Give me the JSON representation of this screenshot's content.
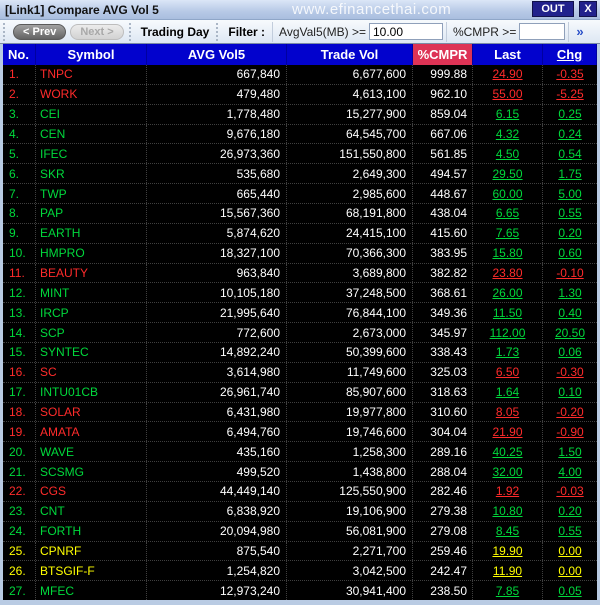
{
  "window": {
    "title": "[Link1] Compare AVG Vol 5",
    "watermark": "www.efinancethai.com",
    "out_label": "OUT",
    "close_label": "X"
  },
  "toolbar": {
    "prev_label": "< Prev",
    "next_label": "Next >",
    "trading_day_label": "Trading Day",
    "filter_label": "Filter :",
    "avgval_label": "AvgVal5(MB) >=",
    "avgval_value": "10.00",
    "cmpr_label": "%CMPR >=",
    "cmpr_value": "",
    "more_label": "»"
  },
  "colors": {
    "up": "#00d93c",
    "down": "#ff2b2b",
    "unchanged": "#ffff00",
    "header_bg": "#0202cd",
    "cmpr_header_bg": "#dd3355",
    "navy_button": "#21218c"
  },
  "table": {
    "columns": [
      "No.",
      "Symbol",
      "AVG Vol5",
      "Trade Vol",
      "%CMPR",
      "Last",
      "Chg"
    ],
    "rows": [
      {
        "no": "1.",
        "symbol": "TNPC",
        "avg_vol5": "667,840",
        "trade_vol": "6,677,600",
        "cmpr": "999.88",
        "last": "24.90",
        "chg": "-0.35",
        "trend": "down"
      },
      {
        "no": "2.",
        "symbol": "WORK",
        "avg_vol5": "479,480",
        "trade_vol": "4,613,100",
        "cmpr": "962.10",
        "last": "55.00",
        "chg": "-5.25",
        "trend": "down"
      },
      {
        "no": "3.",
        "symbol": "CEI",
        "avg_vol5": "1,778,480",
        "trade_vol": "15,277,900",
        "cmpr": "859.04",
        "last": "6.15",
        "chg": "0.25",
        "trend": "up"
      },
      {
        "no": "4.",
        "symbol": "CEN",
        "avg_vol5": "9,676,180",
        "trade_vol": "64,545,700",
        "cmpr": "667.06",
        "last": "4.32",
        "chg": "0.24",
        "trend": "up"
      },
      {
        "no": "5.",
        "symbol": "IFEC",
        "avg_vol5": "26,973,360",
        "trade_vol": "151,550,800",
        "cmpr": "561.85",
        "last": "4.50",
        "chg": "0.54",
        "trend": "up"
      },
      {
        "no": "6.",
        "symbol": "SKR",
        "avg_vol5": "535,680",
        "trade_vol": "2,649,300",
        "cmpr": "494.57",
        "last": "29.50",
        "chg": "1.75",
        "trend": "up"
      },
      {
        "no": "7.",
        "symbol": "TWP",
        "avg_vol5": "665,440",
        "trade_vol": "2,985,600",
        "cmpr": "448.67",
        "last": "60.00",
        "chg": "5.00",
        "trend": "up"
      },
      {
        "no": "8.",
        "symbol": "PAP",
        "avg_vol5": "15,567,360",
        "trade_vol": "68,191,800",
        "cmpr": "438.04",
        "last": "6.65",
        "chg": "0.55",
        "trend": "up"
      },
      {
        "no": "9.",
        "symbol": "EARTH",
        "avg_vol5": "5,874,620",
        "trade_vol": "24,415,100",
        "cmpr": "415.60",
        "last": "7.65",
        "chg": "0.20",
        "trend": "up"
      },
      {
        "no": "10.",
        "symbol": "HMPRO",
        "avg_vol5": "18,327,100",
        "trade_vol": "70,366,300",
        "cmpr": "383.95",
        "last": "15.80",
        "chg": "0.60",
        "trend": "up"
      },
      {
        "no": "11.",
        "symbol": "BEAUTY",
        "avg_vol5": "963,840",
        "trade_vol": "3,689,800",
        "cmpr": "382.82",
        "last": "23.80",
        "chg": "-0.10",
        "trend": "down"
      },
      {
        "no": "12.",
        "symbol": "MINT",
        "avg_vol5": "10,105,180",
        "trade_vol": "37,248,500",
        "cmpr": "368.61",
        "last": "26.00",
        "chg": "1.30",
        "trend": "up"
      },
      {
        "no": "13.",
        "symbol": "IRCP",
        "avg_vol5": "21,995,640",
        "trade_vol": "76,844,100",
        "cmpr": "349.36",
        "last": "11.50",
        "chg": "0.40",
        "trend": "up"
      },
      {
        "no": "14.",
        "symbol": "SCP",
        "avg_vol5": "772,600",
        "trade_vol": "2,673,000",
        "cmpr": "345.97",
        "last": "112.00",
        "chg": "20.50",
        "trend": "up"
      },
      {
        "no": "15.",
        "symbol": "SYNTEC",
        "avg_vol5": "14,892,240",
        "trade_vol": "50,399,600",
        "cmpr": "338.43",
        "last": "1.73",
        "chg": "0.06",
        "trend": "up"
      },
      {
        "no": "16.",
        "symbol": "SC",
        "avg_vol5": "3,614,980",
        "trade_vol": "11,749,600",
        "cmpr": "325.03",
        "last": "6.50",
        "chg": "-0.30",
        "trend": "down"
      },
      {
        "no": "17.",
        "symbol": "INTU01CB",
        "avg_vol5": "26,961,740",
        "trade_vol": "85,907,600",
        "cmpr": "318.63",
        "last": "1.64",
        "chg": "0.10",
        "trend": "up"
      },
      {
        "no": "18.",
        "symbol": "SOLAR",
        "avg_vol5": "6,431,980",
        "trade_vol": "19,977,800",
        "cmpr": "310.60",
        "last": "8.05",
        "chg": "-0.20",
        "trend": "down"
      },
      {
        "no": "19.",
        "symbol": "AMATA",
        "avg_vol5": "6,494,760",
        "trade_vol": "19,746,600",
        "cmpr": "304.04",
        "last": "21.90",
        "chg": "-0.90",
        "trend": "down"
      },
      {
        "no": "20.",
        "symbol": "WAVE",
        "avg_vol5": "435,160",
        "trade_vol": "1,258,300",
        "cmpr": "289.16",
        "last": "40.25",
        "chg": "1.50",
        "trend": "up"
      },
      {
        "no": "21.",
        "symbol": "SCSMG",
        "avg_vol5": "499,520",
        "trade_vol": "1,438,800",
        "cmpr": "288.04",
        "last": "32.00",
        "chg": "4.00",
        "trend": "up"
      },
      {
        "no": "22.",
        "symbol": "CGS",
        "avg_vol5": "44,449,140",
        "trade_vol": "125,550,900",
        "cmpr": "282.46",
        "last": "1.92",
        "chg": "-0.03",
        "trend": "down"
      },
      {
        "no": "23.",
        "symbol": "CNT",
        "avg_vol5": "6,838,920",
        "trade_vol": "19,106,900",
        "cmpr": "279.38",
        "last": "10.80",
        "chg": "0.20",
        "trend": "up"
      },
      {
        "no": "24.",
        "symbol": "FORTH",
        "avg_vol5": "20,094,980",
        "trade_vol": "56,081,900",
        "cmpr": "279.08",
        "last": "8.45",
        "chg": "0.55",
        "trend": "up"
      },
      {
        "no": "25.",
        "symbol": "CPNRF",
        "avg_vol5": "875,540",
        "trade_vol": "2,271,700",
        "cmpr": "259.46",
        "last": "19.90",
        "chg": "0.00",
        "trend": "unchanged"
      },
      {
        "no": "26.",
        "symbol": "BTSGIF-F",
        "avg_vol5": "1,254,820",
        "trade_vol": "3,042,500",
        "cmpr": "242.47",
        "last": "11.90",
        "chg": "0.00",
        "trend": "unchanged"
      },
      {
        "no": "27.",
        "symbol": "MFEC",
        "avg_vol5": "12,973,240",
        "trade_vol": "30,941,400",
        "cmpr": "238.50",
        "last": "7.85",
        "chg": "0.05",
        "trend": "up"
      }
    ]
  }
}
